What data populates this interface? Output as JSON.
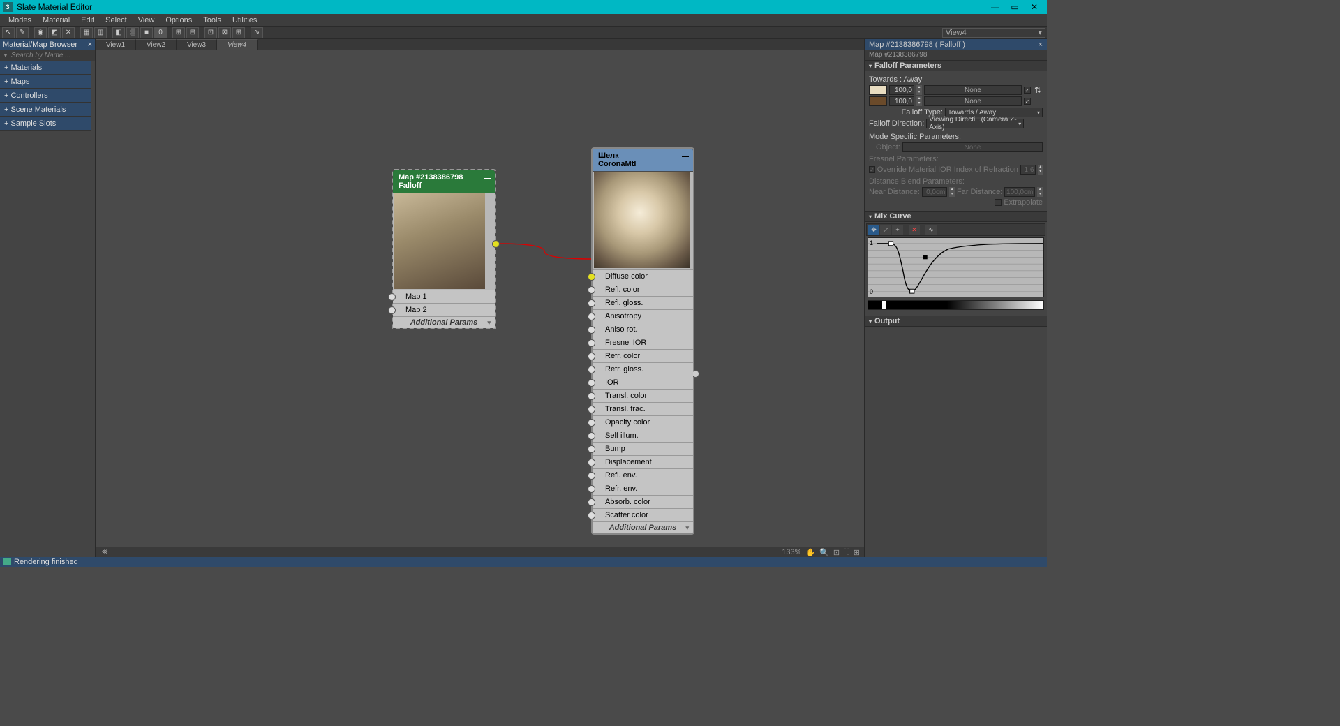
{
  "window": {
    "title": "Slate Material Editor",
    "app_icon": "3"
  },
  "menu": [
    "Modes",
    "Material",
    "Edit",
    "Select",
    "View",
    "Options",
    "Tools",
    "Utilities"
  ],
  "toolbar_view_dropdown": "View4",
  "browser": {
    "title": "Material/Map Browser",
    "search_placeholder": "Search by Name ...",
    "categories": [
      "+ Materials",
      "+ Maps",
      "+ Controllers",
      "+ Scene Materials",
      "+ Sample Slots"
    ]
  },
  "tabs": [
    "View1",
    "View2",
    "View3",
    "View4"
  ],
  "active_tab": 3,
  "node_falloff": {
    "title": "Map #2138386798",
    "subtitle": "Falloff",
    "slots": [
      "Map 1",
      "Map 2"
    ],
    "footer": "Additional Params"
  },
  "node_corona": {
    "title": "Шелк",
    "subtitle": "CoronaMtl",
    "slots": [
      "Diffuse color",
      "Refl. color",
      "Refl. gloss.",
      "Anisotropy",
      "Aniso rot.",
      "Fresnel IOR",
      "Refr. color",
      "Refr. gloss.",
      "IOR",
      "Transl. color",
      "Transl. frac.",
      "Opacity color",
      "Self illum.",
      "Bump",
      "Displacement",
      "Refl. env.",
      "Refr. env.",
      "Absorb. color",
      "Scatter color"
    ],
    "footer": "Additional Params"
  },
  "rp": {
    "title": "Map #2138386798  ( Falloff )",
    "subtitle": "Map #2138386798",
    "rollout_falloff": "Falloff Parameters",
    "towards_away": "Towards : Away",
    "spin_val": "100,0",
    "none_label": "None",
    "falloff_type_label": "Falloff Type:",
    "falloff_type_value": "Towards / Away",
    "falloff_dir_label": "Falloff Direction:",
    "falloff_dir_value": "Viewing Directi...(Camera Z-Axis)",
    "mode_specific": "Mode Specific Parameters:",
    "object_label": "Object:",
    "fresnel_params": "Fresnel Parameters:",
    "override_ior": "Override Material IOR",
    "ior_label": "Index of Refraction",
    "ior_value": "1,6",
    "distance_blend": "Distance Blend Parameters:",
    "near_label": "Near Distance:",
    "near_value": "0,0cm",
    "far_label": "Far Distance:",
    "far_value": "100,0cm",
    "extrapolate": "Extrapolate",
    "rollout_mix": "Mix Curve",
    "rollout_output": "Output",
    "axis0": "0",
    "axis1": "1"
  },
  "status": {
    "zoom": "133%",
    "render": "Rendering finished"
  }
}
